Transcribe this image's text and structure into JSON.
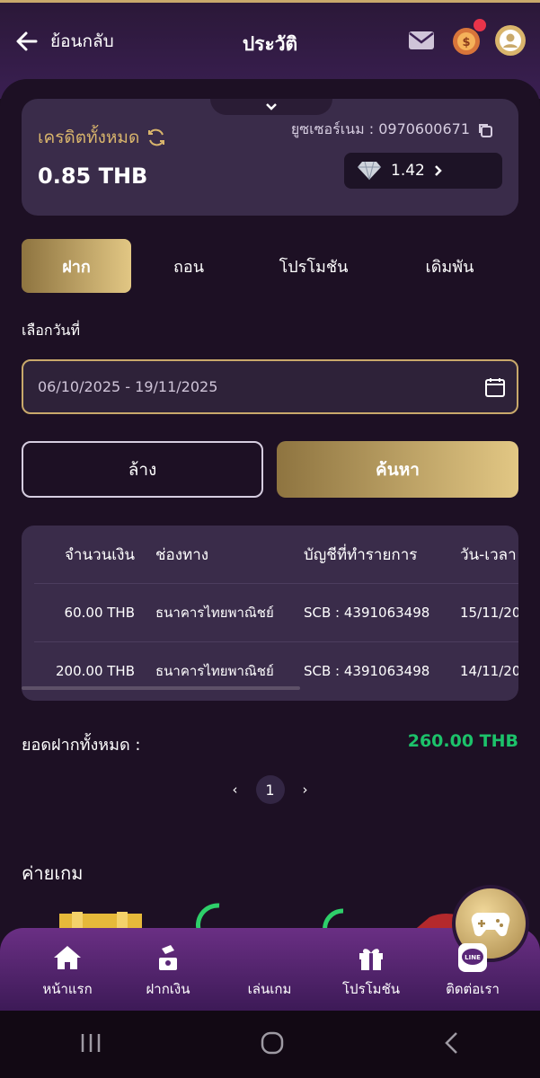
{
  "header": {
    "back_label": "ย้อนกลับ",
    "title": "ประวัติ",
    "icons": [
      "mail-icon",
      "coin-badge-icon",
      "user-avatar-icon"
    ]
  },
  "credit": {
    "label": "เครดิตทั้งหมด",
    "value": "0.85 THB",
    "username_label": "ยูซเซอร์เนม : 0970600671",
    "diamond_value": "1.42"
  },
  "tabs": [
    {
      "label": "ฝาก",
      "active": true
    },
    {
      "label": "ถอน",
      "active": false
    },
    {
      "label": "โปรโมชัน",
      "active": false
    },
    {
      "label": "เดิมพัน",
      "active": false
    }
  ],
  "date": {
    "label": "เลือกวันที่",
    "value": "06/10/2025 - 19/11/2025"
  },
  "buttons": {
    "clear": "ล้าง",
    "search": "ค้นหา"
  },
  "table": {
    "headers": [
      "จำนวนเงิน",
      "ช่องทาง",
      "บัญชีที่ทำรายการ",
      "วัน-เวลา"
    ],
    "rows": [
      [
        "60.00 THB",
        "ธนาคารไทยพาณิชย์",
        "SCB : 4391063498",
        "15/11/20"
      ],
      [
        "200.00 THB",
        "ธนาคารไทยพาณิชย์",
        "SCB : 4391063498",
        "14/11/20"
      ]
    ]
  },
  "total": {
    "label": "ยอดฝากทั้งหมด :",
    "value": "260.00 THB"
  },
  "pagination": {
    "current": "1",
    "prev": "‹",
    "next": "›"
  },
  "providers": {
    "title": "ค่ายเกม"
  },
  "bottom_nav": [
    {
      "label": "หน้าแรก",
      "icon": "home-icon"
    },
    {
      "label": "ฝากเงิน",
      "icon": "deposit-icon"
    },
    {
      "label": "เล่นเกม",
      "icon": "gamepad-icon"
    },
    {
      "label": "โปรโมชัน",
      "icon": "gift-icon"
    },
    {
      "label": "ติดต่อเรา",
      "icon": "line-icon"
    }
  ],
  "colors": {
    "gold": "#d9b56c",
    "total_green": "#1cc26a",
    "background": "#1d1024",
    "card": "#3a2c4a"
  }
}
